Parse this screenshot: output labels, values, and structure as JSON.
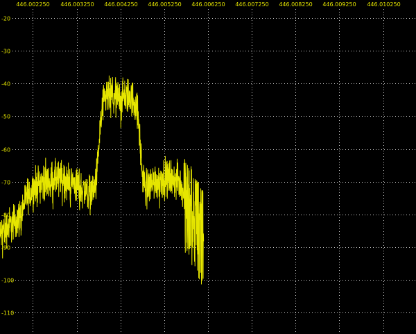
{
  "colors": {
    "background": "#000000",
    "trace": "#e6e600",
    "labels": "#e6e600",
    "grid": "#cfcfcf"
  },
  "chart_data": {
    "type": "line",
    "title": "",
    "xlabel": "",
    "ylabel": "",
    "grid": true,
    "xlim": [
      446.0015,
      446.011
    ],
    "ylim": [
      -116.5,
      -14.5
    ],
    "x_ticks": [
      {
        "value": 446.00225,
        "label": "446.002250"
      },
      {
        "value": 446.00325,
        "label": "446.003250"
      },
      {
        "value": 446.00425,
        "label": "446.004250"
      },
      {
        "value": 446.00525,
        "label": "446.005250"
      },
      {
        "value": 446.00625,
        "label": "446.006250"
      },
      {
        "value": 446.00725,
        "label": "446.007250"
      },
      {
        "value": 446.00825,
        "label": "446.008250"
      },
      {
        "value": 446.00925,
        "label": "446.009250"
      },
      {
        "value": 446.01025,
        "label": "446.010250"
      }
    ],
    "y_ticks": [
      {
        "value": -20,
        "label": "-20"
      },
      {
        "value": -30,
        "label": "-30"
      },
      {
        "value": -40,
        "label": "-40"
      },
      {
        "value": -50,
        "label": "-50"
      },
      {
        "value": -60,
        "label": "-60"
      },
      {
        "value": -70,
        "label": "-70"
      },
      {
        "value": -80,
        "label": "-80"
      },
      {
        "value": -90,
        "label": "-90"
      },
      {
        "value": -100,
        "label": "-100"
      },
      {
        "value": -110,
        "label": "-110"
      }
    ],
    "series": [
      {
        "values_x_start": 446.0015,
        "values_x_step": 5e-05,
        "values": [
          -87,
          -85,
          -84.5,
          -84,
          -83.5,
          -83,
          -82.5,
          -82,
          -81.5,
          -81,
          -79,
          -76.5,
          -75,
          -74,
          -73,
          -72,
          -71.5,
          -71,
          -70.5,
          -70,
          -70,
          -70,
          -69.5,
          -69.5,
          -69.5,
          -69.5,
          -69,
          -69,
          -69,
          -69,
          -69.5,
          -70,
          -70,
          -70,
          -70.5,
          -71,
          -71.5,
          -72,
          -72.5,
          -72.5,
          -73,
          -73.5,
          -73,
          -72,
          -70,
          -60,
          -52,
          -47,
          -45,
          -44,
          -44,
          -44,
          -44,
          -44,
          -44,
          -44,
          -44,
          -44,
          -44,
          -44,
          -44.5,
          -45,
          -46,
          -50,
          -58,
          -68,
          -71,
          -71.5,
          -71,
          -70.5,
          -70,
          -70,
          -70,
          -69.5,
          -69,
          -69,
          -69,
          -69,
          -69,
          -69,
          -69.5,
          -70,
          -70.5,
          -71.5,
          -73,
          -75,
          -76,
          -77,
          -78,
          -79.5,
          -81,
          -82.5,
          -84,
          -85
        ],
        "noise_amplitude_db": 7,
        "channel_noise_amplitude_db": 14
      }
    ]
  }
}
